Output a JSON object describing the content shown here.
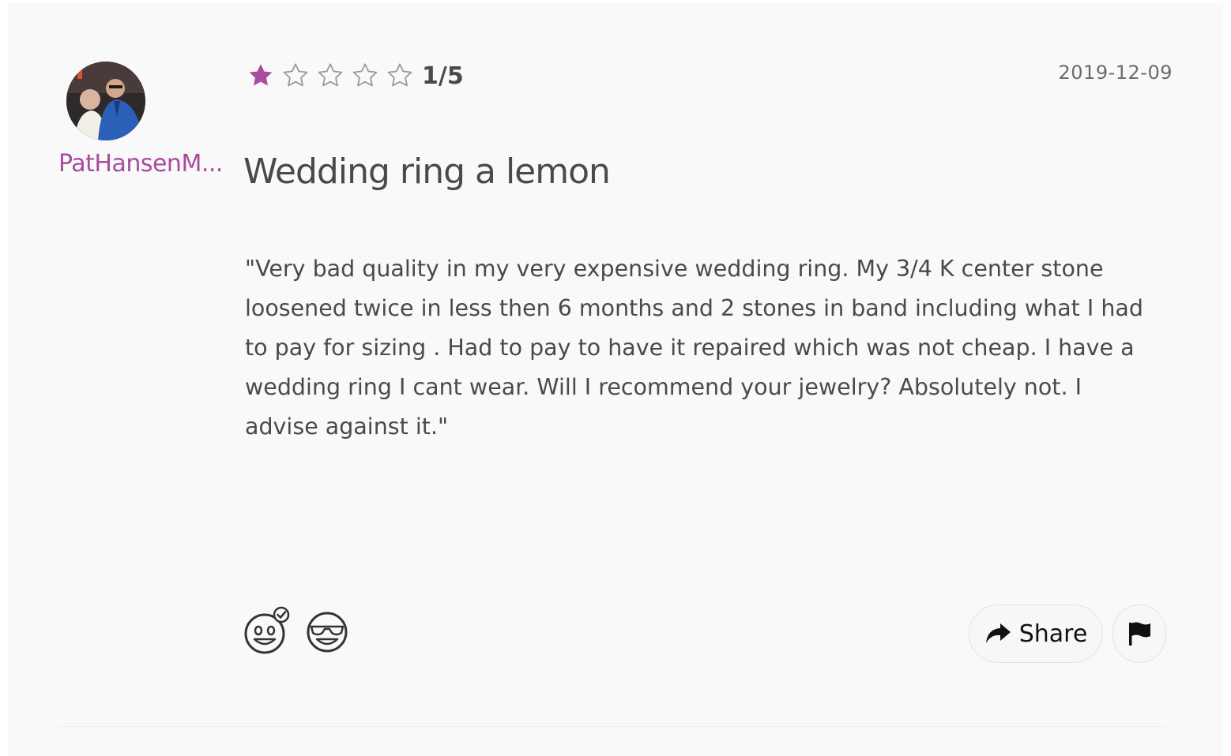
{
  "review": {
    "author": {
      "username": "PatHansenM...",
      "avatar_icon": "user-photo-avatar"
    },
    "rating": {
      "value": 1,
      "max": 5,
      "label": "1/5",
      "filled_color": "#a94b9e",
      "empty_color": "#9a9a9a"
    },
    "date": "2019-12-09",
    "title": "Wedding ring a lemon",
    "body": "\"Very bad quality in my very expensive wedding ring. My 3/4 K center stone loosened twice in less then 6 months and 2 stones in band including what I had to pay for sizing . Had to pay to have it repaired which was not cheap. I have a wedding ring I cant wear. Will I recommend your jewelry? Absolutely not. I advise against it.\"",
    "reactions": [
      {
        "icon": "smiley-check-reaction-icon"
      },
      {
        "icon": "sunglasses-smiley-reaction-icon"
      }
    ],
    "actions": {
      "share_label": "Share",
      "share_icon": "share-arrow-icon",
      "report_icon": "flag-icon"
    }
  },
  "colors": {
    "accent": "#a94b9e",
    "text": "#4a4a4a",
    "background": "#f9f9f9"
  }
}
